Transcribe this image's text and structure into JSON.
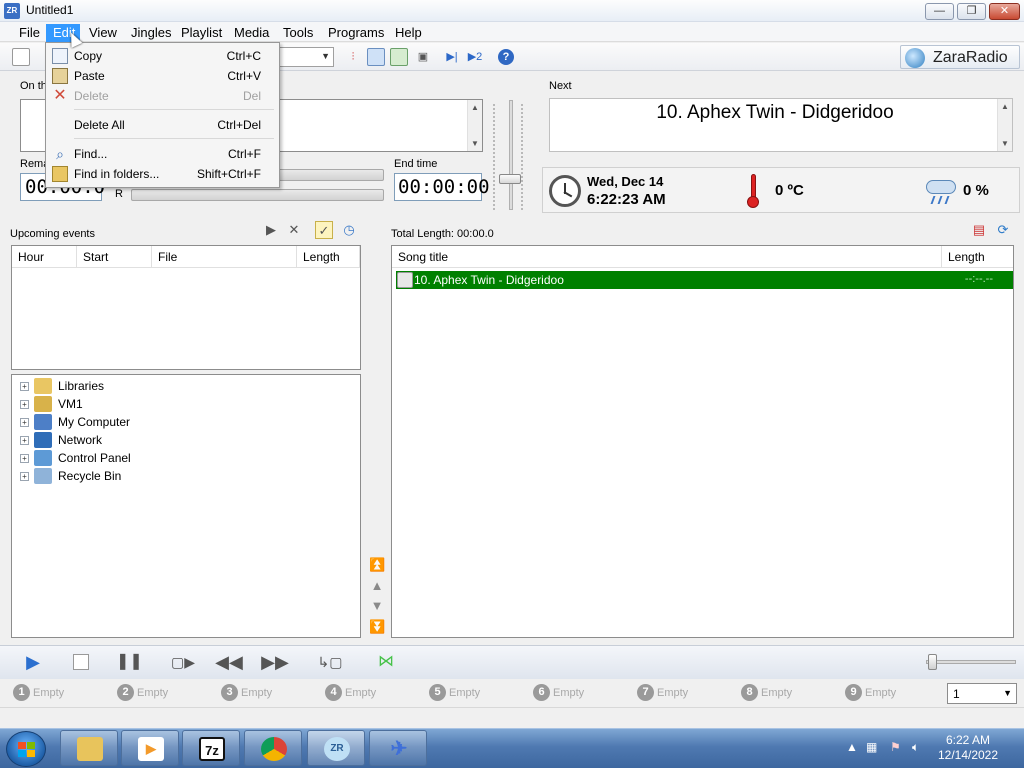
{
  "window": {
    "title": "Untitled1",
    "app_icon_text": "ZR",
    "controls": {
      "minimize": "—",
      "maximize": "❐",
      "close": "✕"
    }
  },
  "menubar": {
    "items": [
      "File",
      "Edit",
      "View",
      "Jingles",
      "Playlist",
      "Media",
      "Tools",
      "Programs",
      "Help"
    ],
    "active": "Edit"
  },
  "edit_menu": {
    "items": [
      {
        "label": "Copy",
        "shortcut": "Ctrl+C",
        "icon": "copy-icon",
        "enabled": true
      },
      {
        "label": "Paste",
        "shortcut": "Ctrl+V",
        "icon": "paste-icon",
        "enabled": true
      },
      {
        "label": "Delete",
        "shortcut": "Del",
        "icon": "delete-icon",
        "enabled": false
      },
      {
        "label": "Delete All",
        "shortcut": "Ctrl+Del",
        "icon": "",
        "enabled": true
      },
      {
        "label": "Find...",
        "shortcut": "Ctrl+F",
        "icon": "find-icon",
        "enabled": true
      },
      {
        "label": "Find in folders...",
        "shortcut": "Shift+Ctrl+F",
        "icon": "find-folders-icon",
        "enabled": true
      }
    ]
  },
  "brand": {
    "name": "ZaraRadio"
  },
  "on_air": {
    "label": "On th",
    "remaining_label": "Rema",
    "remaining_value": "00:00.0",
    "end_time_label": "End time",
    "end_time_value": "00:00:00",
    "channel_r": "R"
  },
  "next": {
    "label": "Next",
    "song": "10. Aphex Twin - Didgeridoo"
  },
  "info": {
    "date": "Wed, Dec 14",
    "time": "6:22:23 AM",
    "temperature": "0 ºC",
    "precipitation": "0 %"
  },
  "events": {
    "label": "Upcoming events",
    "columns": [
      "Hour",
      "Start",
      "File",
      "Length"
    ],
    "buttons": {
      "play": "▶",
      "remove": "✕"
    }
  },
  "tree": {
    "items": [
      {
        "label": "Libraries",
        "icon": "libraries-icon",
        "color": "#e9c663"
      },
      {
        "label": "VM1",
        "icon": "user-folder-icon",
        "color": "#d8b24a"
      },
      {
        "label": "My Computer",
        "icon": "computer-icon",
        "color": "#4d7fc7"
      },
      {
        "label": "Network",
        "icon": "network-icon",
        "color": "#2f6db8"
      },
      {
        "label": "Control Panel",
        "icon": "control-panel-icon",
        "color": "#5d9ad6"
      },
      {
        "label": "Recycle Bin",
        "icon": "recycle-bin-icon",
        "color": "#8fb3d9"
      }
    ]
  },
  "playlist": {
    "total_length_label": "Total Length: 00:00.0",
    "columns": [
      "Song title",
      "Length"
    ],
    "rows": [
      {
        "title": "10. Aphex Twin - Didgeridoo",
        "length": "--:--.--",
        "selected": true
      }
    ]
  },
  "carts": [
    {
      "num": "1",
      "label": "Empty"
    },
    {
      "num": "2",
      "label": "Empty"
    },
    {
      "num": "3",
      "label": "Empty"
    },
    {
      "num": "4",
      "label": "Empty"
    },
    {
      "num": "5",
      "label": "Empty"
    },
    {
      "num": "6",
      "label": "Empty"
    },
    {
      "num": "7",
      "label": "Empty"
    },
    {
      "num": "8",
      "label": "Empty"
    },
    {
      "num": "9",
      "label": "Empty"
    }
  ],
  "cart_page": "1",
  "taskbar": {
    "apps": [
      {
        "name": "explorer",
        "glyph": "",
        "color": "#e8c45c"
      },
      {
        "name": "media-player",
        "glyph": "▶",
        "color": "#f39a2a"
      },
      {
        "name": "7zip",
        "glyph": "7z",
        "color": "#111"
      },
      {
        "name": "chrome",
        "glyph": "",
        "color": "#db4437"
      },
      {
        "name": "zararadio",
        "glyph": "ZR",
        "color": "#3a8ccf"
      },
      {
        "name": "bird-app",
        "glyph": "✈",
        "color": "#3f6fd8"
      }
    ],
    "time": "6:22 AM",
    "date": "12/14/2022"
  }
}
